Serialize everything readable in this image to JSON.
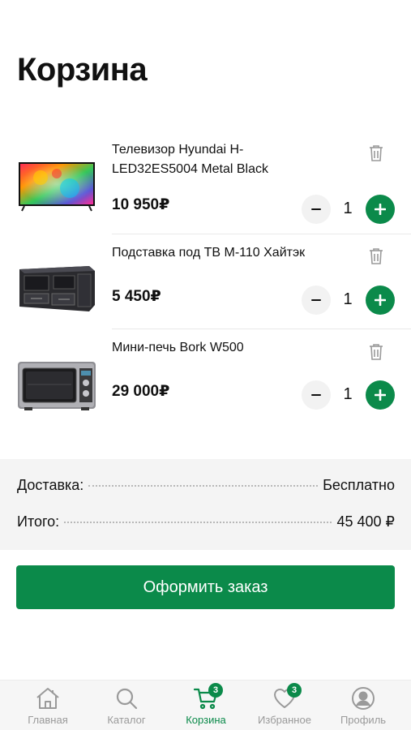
{
  "page": {
    "title": "Корзина"
  },
  "items": [
    {
      "name": "Телевизор Hyundai H-LED32ES5004 Metal Black",
      "price": "10 950₽",
      "qty": "1"
    },
    {
      "name": "Подставка под ТВ М-110 Хайтэк",
      "price": "5 450₽",
      "qty": "1"
    },
    {
      "name": "Мини-печь Bork W500",
      "price": "29 000₽",
      "qty": "1"
    }
  ],
  "summary": {
    "delivery_label": "Доставка:",
    "delivery_value": "Бесплатно",
    "total_label": "Итого:",
    "total_value": "45 400 ₽"
  },
  "order_button": "Оформить заказ",
  "tabbar": {
    "tabs": [
      {
        "label": "Главная",
        "icon": "home-icon"
      },
      {
        "label": "Каталог",
        "icon": "search-icon"
      },
      {
        "label": "Корзина",
        "icon": "cart-icon",
        "badge": "3",
        "active": true
      },
      {
        "label": "Избранное",
        "icon": "heart-icon",
        "badge": "3"
      },
      {
        "label": "Профиль",
        "icon": "profile-icon"
      }
    ]
  },
  "colors": {
    "accent": "#0b8a4a",
    "inactive": "#9a9a9a",
    "summary_bg": "#f4f4f4"
  }
}
